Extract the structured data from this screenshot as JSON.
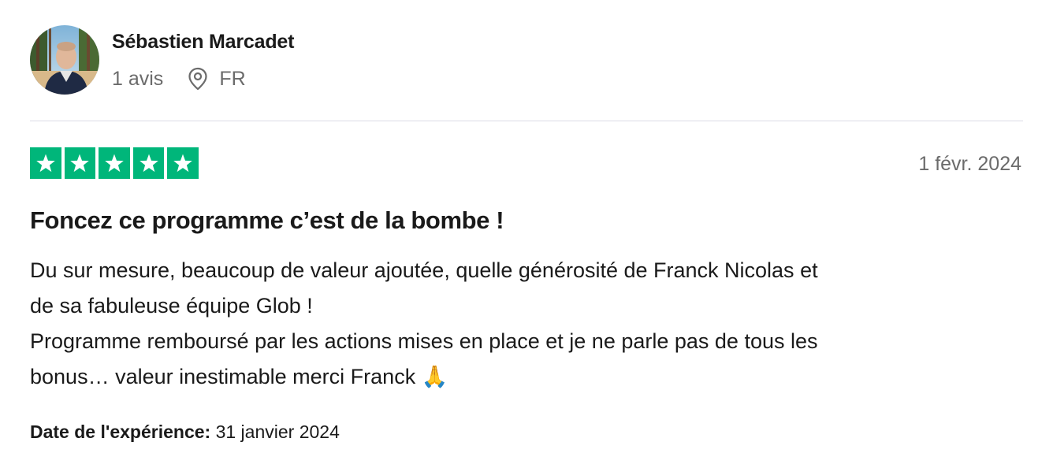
{
  "reviewer": {
    "name": "Sébastien Marcadet",
    "reviews_count": "1 avis",
    "country": "FR",
    "avatar_icon": "avatar-photo"
  },
  "review": {
    "rating": 5,
    "rating_max": 5,
    "star_color": "#00b67a",
    "date": "1 févr. 2024",
    "title": "Foncez ce programme c’est de la bombe !",
    "body_lines": [
      "Du sur mesure, beaucoup de valeur ajoutée, quelle générosité de Franck Nicolas et",
      "de sa fabuleuse équipe Glob !",
      "Programme remboursé par les actions mises en place et je ne parle pas de tous les",
      "bonus… valeur inestimable merci Franck 🙏"
    ],
    "experience_label": "Date de l'expérience:",
    "experience_date": "31 janvier 2024"
  },
  "icons": {
    "location": "location-pin-icon",
    "star": "star-icon",
    "emoji": "folded-hands-emoji"
  }
}
